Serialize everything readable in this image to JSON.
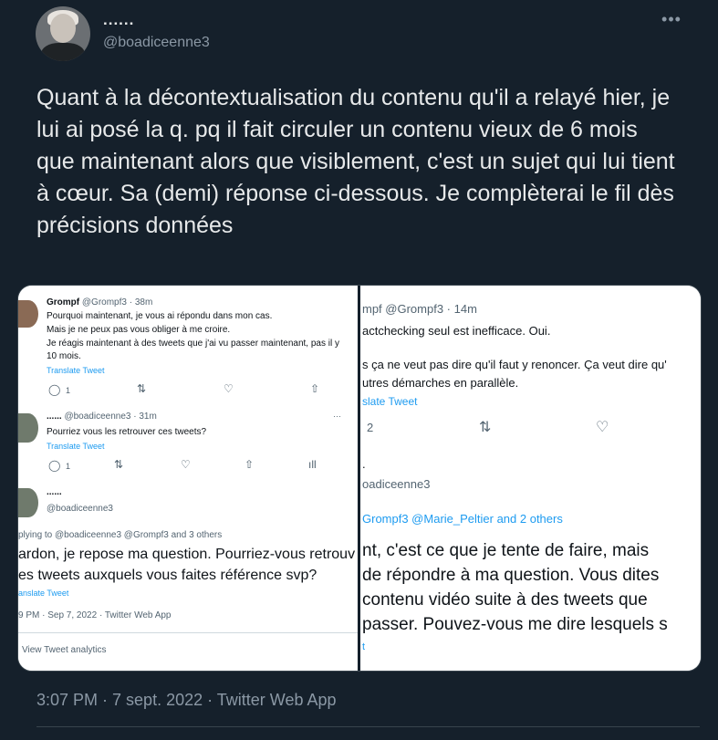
{
  "author": {
    "name": "......",
    "handle": "@boadiceenne3"
  },
  "tweet_text": "Quant à la décontextualisation du contenu qu'il a relayé hier, je lui ai posé la q. pq il fait circuler un contenu vieux de 6 mois que maintenant alors que visiblement, c'est un sujet qui lui tient à cœur. Sa (demi) réponse ci-dessous. Je complèterai le fil dès précisions données",
  "timestamp": "3:07 PM · 7 sept. 2022 · Twitter Web App",
  "left_image": {
    "t1_name": "Grompf",
    "t1_handle": "@Grompf3 · 38m",
    "t1_l1": "Pourquoi maintenant, je vous ai répondu dans mon cas.",
    "t1_l2": "Mais je ne peux pas vous obliger à me croire.",
    "t1_l3": "Je réagis maintenant à des tweets que j'ai vu passer maintenant, pas il y",
    "t1_l4": "10 mois.",
    "translate": "Translate Tweet",
    "t1_reply_count": "1",
    "t2_name": "......",
    "t2_handle": "@boadiceenne3 · 31m",
    "t2_text": "Pourriez vous les retrouver ces tweets?",
    "t2_reply_count": "1",
    "t3_name": "......",
    "t3_handle": "@boadiceenne3",
    "replying": "plying to @boadiceenne3 @Grompf3 and 3 others",
    "big1": "ardon, je repose ma question. Pourriez-vous retrouv",
    "big2": "es tweets auxquels vous faites référence svp?",
    "translate_cut": "anslate Tweet",
    "meta": "9 PM · Sep 7, 2022 · Twitter Web App",
    "analytics": "View Tweet analytics"
  },
  "right_image": {
    "header": "mpf @Grompf3 · 14m",
    "l1": "actchecking seul est inefficace. Oui.",
    "l2": "s ça ne veut pas dire qu'il faut y renoncer. Ça veut dire qu'",
    "l3": "utres démarches en parallèle.",
    "translate": "slate Tweet",
    "reply_count": "2",
    "dot": ".",
    "handle": "oadiceenne3",
    "replying": "Grompf3 @Marie_Peltier and 2 others",
    "b1": "nt, c'est ce que je tente de faire, mais",
    "b2": "de répondre à ma question. Vous dites",
    "b3": "contenu vidéo suite à des tweets que",
    "b4": "passer. Pouvez-vous me dire lesquels s",
    "tail": "t"
  }
}
